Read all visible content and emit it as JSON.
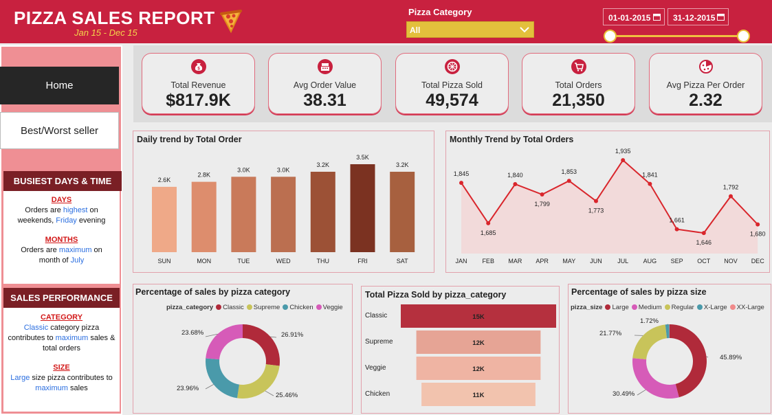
{
  "header": {
    "title": "PIZZA SALES REPORT",
    "subtitle": "Jan 15 - Dec 15",
    "filter_label": "Pizza Category",
    "filter_value": "All",
    "date_from": "01-01-2015",
    "date_to": "31-12-2015"
  },
  "sidebar": {
    "nav": [
      {
        "label": "Home"
      },
      {
        "label": "Best/Worst seller"
      }
    ],
    "busiest": {
      "heading": "BUSIEST DAYS & TIME",
      "days_title": "DAYS",
      "days_pre": "Orders are ",
      "days_hl1": "highest",
      "days_mid": " on weekends, ",
      "days_hl2": "Friday",
      "days_post": " evening",
      "months_title": "MONTHS",
      "months_pre": "Orders are ",
      "months_hl1": "maximum",
      "months_mid": " on month of ",
      "months_hl2": "July"
    },
    "performance": {
      "heading": "SALES PERFORMANCE",
      "category_title": "CATEGORY",
      "cat_hl1": "Classic",
      "cat_mid": " category pizza contributes to ",
      "cat_hl2": "maximum",
      "cat_post": " sales & total orders",
      "size_title": "SIZE",
      "size_hl1": "Large",
      "size_mid": " size pizza contributes to ",
      "size_hl2": "maximum",
      "size_post": " sales"
    }
  },
  "kpis": [
    {
      "label": "Total Revenue",
      "value": "$817.9K",
      "icon": "money-bag-icon"
    },
    {
      "label": "Avg Order Value",
      "value": "38.31",
      "icon": "cash-register-icon"
    },
    {
      "label": "Total Pizza Sold",
      "value": "49,574",
      "icon": "pizza-icon"
    },
    {
      "label": "Total Orders",
      "value": "21,350",
      "icon": "cart-icon"
    },
    {
      "label": "Avg Pizza Per Order",
      "value": "2.32",
      "icon": "pizza-slice-icon"
    }
  ],
  "colors": {
    "brand": "#c8213f",
    "accent": "#e3c03c",
    "line": "#d9262c"
  },
  "chart_data": [
    {
      "type": "bar",
      "title": "Daily trend by Total Order",
      "categories": [
        "SUN",
        "MON",
        "TUE",
        "WED",
        "THU",
        "FRI",
        "SAT"
      ],
      "values": [
        2.6,
        2.8,
        3.0,
        3.0,
        3.2,
        3.5,
        3.2
      ],
      "data_labels": [
        "2.6K",
        "2.8K",
        "3.0K",
        "3.0K",
        "3.2K",
        "3.5K",
        "3.2K"
      ],
      "unit": "K",
      "ylim": [
        0,
        3.5
      ],
      "bar_colors": [
        "#efa988",
        "#dd8d6d",
        "#c97a5a",
        "#bb6f50",
        "#9c5136",
        "#7b3221",
        "#a7603f"
      ]
    },
    {
      "type": "line",
      "title": "Monthly Trend by Total Orders",
      "categories": [
        "JAN",
        "FEB",
        "MAR",
        "APR",
        "MAY",
        "JUN",
        "JUL",
        "AUG",
        "SEP",
        "OCT",
        "NOV",
        "DEC"
      ],
      "values": [
        1845,
        1685,
        1840,
        1799,
        1853,
        1773,
        1935,
        1841,
        1661,
        1646,
        1792,
        1680
      ],
      "data_labels": [
        "1,845",
        "1,685",
        "1,840",
        "1,799",
        "1,853",
        "1,773",
        "1,935",
        "1,841",
        "1,661",
        "1,646",
        "1,792",
        "1,680"
      ],
      "ylim": [
        1600,
        1960
      ]
    },
    {
      "type": "pie",
      "title": "Percentage of sales by pizza category",
      "legend_title": "pizza_category",
      "categories": [
        "Classic",
        "Supreme",
        "Chicken",
        "Veggie"
      ],
      "values": [
        26.91,
        25.46,
        23.96,
        23.68
      ],
      "data_labels": [
        "26.91%",
        "25.46%",
        "23.96%",
        "23.68%"
      ],
      "colors": [
        "#b02a3a",
        "#c8c45a",
        "#4a9aaa",
        "#d65bb8"
      ],
      "legend": "top"
    },
    {
      "type": "bar",
      "title": "Total Pizza Sold by pizza_category",
      "categories": [
        "Classic",
        "Supreme",
        "Veggie",
        "Chicken"
      ],
      "values": [
        15,
        12,
        12,
        11
      ],
      "data_labels": [
        "15K",
        "12K",
        "12K",
        "11K"
      ],
      "unit": "K",
      "orientation": "horizontal-funnel",
      "colors": [
        "#b5303e",
        "#e6a495",
        "#efb4a3",
        "#f2c3ae"
      ]
    },
    {
      "type": "pie",
      "title": "Percentage of sales by pizza size",
      "legend_title": "pizza_size",
      "categories": [
        "Large",
        "Medium",
        "Regular",
        "X-Large",
        "XX-Large"
      ],
      "values": [
        45.89,
        30.49,
        21.77,
        1.72,
        0.12
      ],
      "data_labels": [
        "45.89%",
        "30.49%",
        "21.77%",
        "1.72%",
        ""
      ],
      "colors": [
        "#b02a3a",
        "#d65bb8",
        "#c8c45a",
        "#4a9aaa",
        "#f08a8a"
      ],
      "legend": "top"
    }
  ]
}
